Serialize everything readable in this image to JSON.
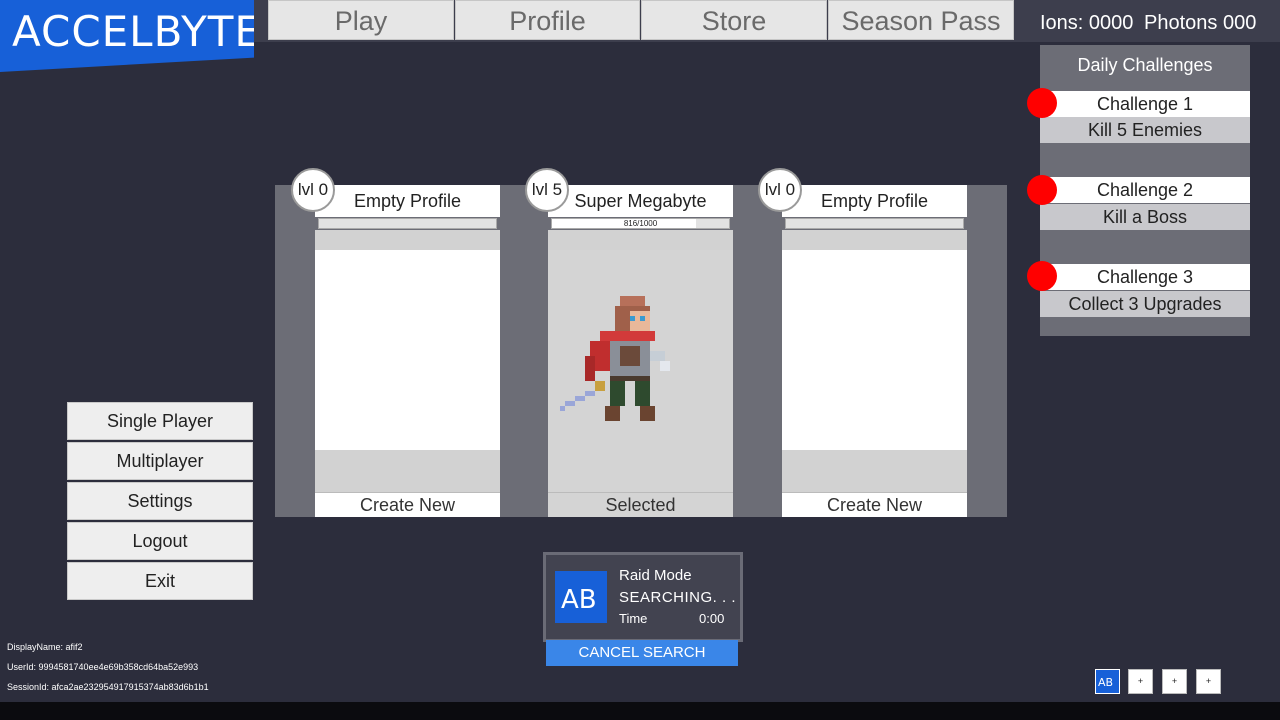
{
  "logo": {
    "text": "ACCELBYTE"
  },
  "nav": {
    "tabs": [
      {
        "label": "Play"
      },
      {
        "label": "Profile"
      },
      {
        "label": "Store"
      },
      {
        "label": "Season Pass"
      }
    ]
  },
  "currency": {
    "ions": "Ions: 0000",
    "photons": "Photons  000"
  },
  "daily_challenges": {
    "title": "Daily Challenges",
    "items": [
      {
        "name": "Challenge 1",
        "desc": "Kill 5 Enemies"
      },
      {
        "name": "Challenge 2",
        "desc": "Kill a Boss"
      },
      {
        "name": "Challenge 3",
        "desc": "Collect 3 Upgrades"
      }
    ]
  },
  "profiles": [
    {
      "level": "lvl 0",
      "name": "Empty Profile",
      "xp_fraction": 0.0,
      "xp_text": "",
      "button": "Create New"
    },
    {
      "level": "lvl 5",
      "name": "Super Megabyte",
      "xp_fraction": 0.816,
      "xp_text": "816/1000",
      "button": "Selected"
    },
    {
      "level": "lvl 0",
      "name": "Empty Profile",
      "xp_fraction": 0.0,
      "xp_text": "",
      "button": "Create New"
    }
  ],
  "menu": {
    "items": [
      {
        "label": "Single Player"
      },
      {
        "label": "Multiplayer"
      },
      {
        "label": "Settings"
      },
      {
        "label": "Logout"
      },
      {
        "label": "Exit"
      }
    ]
  },
  "matchmaking": {
    "mode": "Raid Mode",
    "status": "SEARCHING. . .",
    "time_label": "Time",
    "time_value": "0:00",
    "cancel_label": "CANCEL SEARCH"
  },
  "user_info": {
    "display_name": "DisplayName: afif2",
    "user_id": "UserId: 9994581740ee4e69b358cd64ba52e993",
    "session_id": "SessionId: afca2ae232954917915374ab83d6b1b1"
  },
  "colors": {
    "brand_blue": "#1760d8",
    "background": "#2c2d3c",
    "challenge_dot": "#ff0000",
    "cancel_button": "#3a86e8"
  },
  "icons": {
    "logo_mark": "accelbyte-icon",
    "challenge_marker": "red-dot-icon"
  }
}
